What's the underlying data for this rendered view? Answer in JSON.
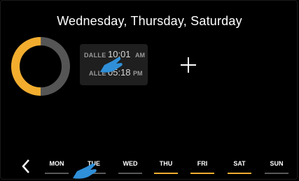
{
  "header": {
    "title": "Wednesday, Thursday, Saturday"
  },
  "schedule": {
    "from_label": "DALLE",
    "from_time": "10:01",
    "from_ampm": "AM",
    "to_label": "ALLE",
    "to_time": "05:18",
    "to_ampm": "PM"
  },
  "ring": {
    "active_fraction": 0.5,
    "active_color": "#f2ad2e",
    "inactive_color": "#555555"
  },
  "days": [
    {
      "label": "MON",
      "active": false
    },
    {
      "label": "TUE",
      "active": false
    },
    {
      "label": "WED",
      "active": false
    },
    {
      "label": "THU",
      "active": true
    },
    {
      "label": "FRI",
      "active": true
    },
    {
      "label": "SAT",
      "active": true
    },
    {
      "label": "SUN",
      "active": false
    }
  ],
  "colors": {
    "accent": "#f2ad2e",
    "inactive": "#595959",
    "gesture": "#2f8fd8"
  },
  "icons": {
    "add": "plus-icon",
    "back": "chevron-left-icon",
    "gesture": "touch-hand-icon"
  }
}
